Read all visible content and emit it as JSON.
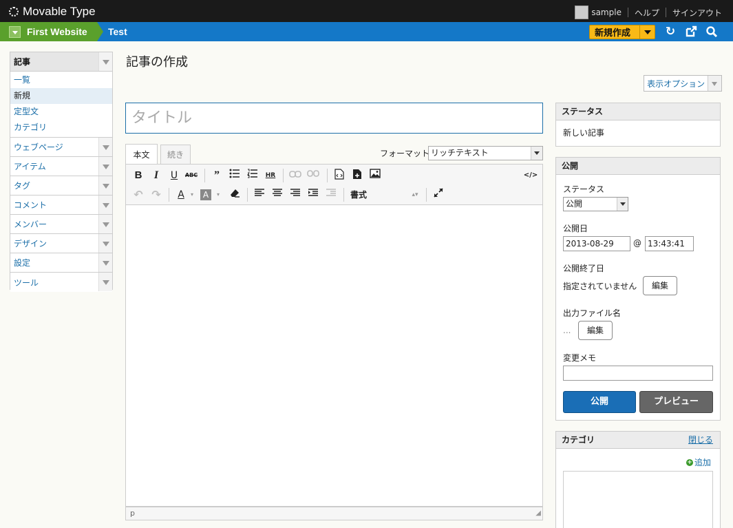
{
  "app": {
    "name": "Movable Type"
  },
  "topbar": {
    "user": "sample",
    "help": "ヘルプ",
    "signout": "サインアウト"
  },
  "context": {
    "website": "First Website",
    "blog": "Test",
    "new_button": "新規作成"
  },
  "sidebar": {
    "sections": [
      {
        "label": "記事",
        "active": true,
        "items": [
          "一覧",
          "新規",
          "定型文",
          "カテゴリ"
        ],
        "current": "新規"
      },
      {
        "label": "ウェブページ"
      },
      {
        "label": "アイテム"
      },
      {
        "label": "タグ"
      },
      {
        "label": "コメント"
      },
      {
        "label": "メンバー"
      },
      {
        "label": "デザイン"
      },
      {
        "label": "設定"
      },
      {
        "label": "ツール"
      }
    ]
  },
  "main": {
    "page_title": "記事の作成",
    "display_options": "表示オプション",
    "title_placeholder": "タイトル",
    "tabs": [
      "本文",
      "続き"
    ],
    "format_label": "フォーマット:",
    "format_value": "リッチテキスト",
    "toolbar_row1": [
      "B",
      "I",
      "U",
      "ABC",
      "99",
      "ul",
      "ol",
      "HR",
      "link",
      "unlink",
      "code",
      "file",
      "image",
      "</>"
    ],
    "toolbar_row2": [
      "undo",
      "redo",
      "A",
      "A",
      "eraser",
      "left",
      "center",
      "right",
      "indent",
      "outdent",
      "書式",
      "fullscreen"
    ],
    "statusbar": "p"
  },
  "status_widget": {
    "title": "ステータス",
    "value": "新しい記事"
  },
  "publish_widget": {
    "title": "公開",
    "status_label": "ステータス",
    "status_value": "公開",
    "date_label": "公開日",
    "date": "2013-08-29",
    "at": "@",
    "time": "13:43:41",
    "end_label": "公開終了日",
    "end_value": "指定されていません",
    "edit": "編集",
    "filename_label": "出力ファイル名",
    "filename_value": "...",
    "memo_label": "変更メモ",
    "publish_button": "公開",
    "preview_button": "プレビュー"
  },
  "category_widget": {
    "title": "カテゴリ",
    "close": "閉じる",
    "add": "追加"
  },
  "colors": {
    "accent": "#1478c8",
    "site": "#5aa02c",
    "new": "#f8b917"
  }
}
